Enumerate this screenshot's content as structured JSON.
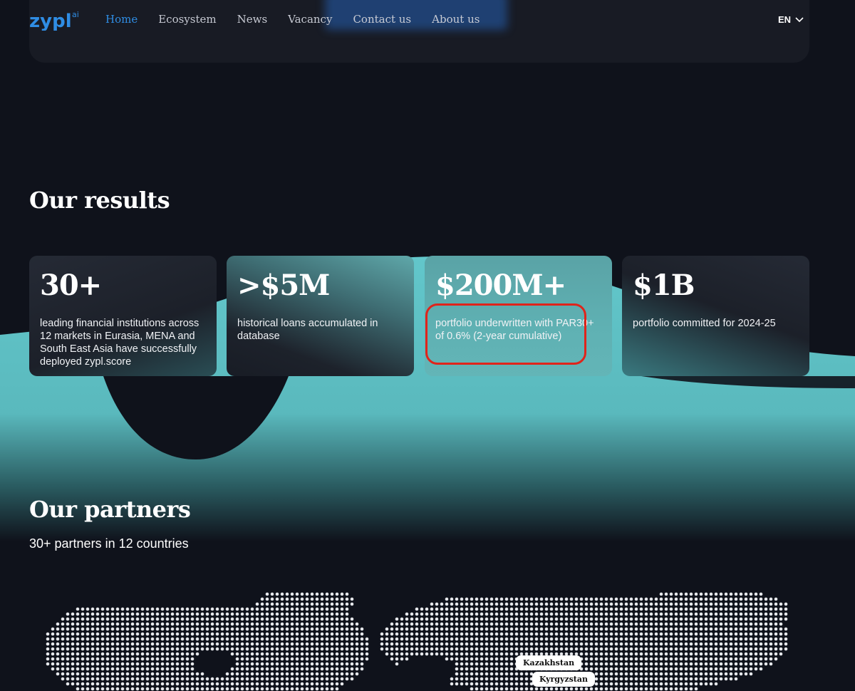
{
  "nav": {
    "logo": "zypl",
    "logo_suffix": "ai",
    "links": [
      {
        "label": "Home",
        "active": true
      },
      {
        "label": "Ecosystem"
      },
      {
        "label": "News"
      },
      {
        "label": "Vacancy"
      },
      {
        "label": "Contact us"
      },
      {
        "label": "About us"
      }
    ],
    "language": "EN"
  },
  "results": {
    "title": "Our results",
    "cards": [
      {
        "value": "30+",
        "description": "leading financial institutions across 12 markets in Eurasia, MENA and South East Asia have successfully deployed zypl.score"
      },
      {
        "value": ">$5M",
        "description": "historical loans accumulated in database"
      },
      {
        "value": "$200M+",
        "description": "portfolio underwritten with PAR30+ of 0.6% (2-year cumulative)",
        "highlighted": true
      },
      {
        "value": "$1B",
        "description": "portfolio committed for 2024-25"
      }
    ]
  },
  "partners": {
    "title": "Our partners",
    "subtitle": "30+ partners in 12 countries",
    "map_labels": [
      "Kazakhstan",
      "Kyrgyzstan"
    ]
  },
  "colors": {
    "accent": "#2f8de4",
    "teal": "#5fc4c8",
    "background": "#0f121b",
    "highlight": "#e0241b"
  }
}
